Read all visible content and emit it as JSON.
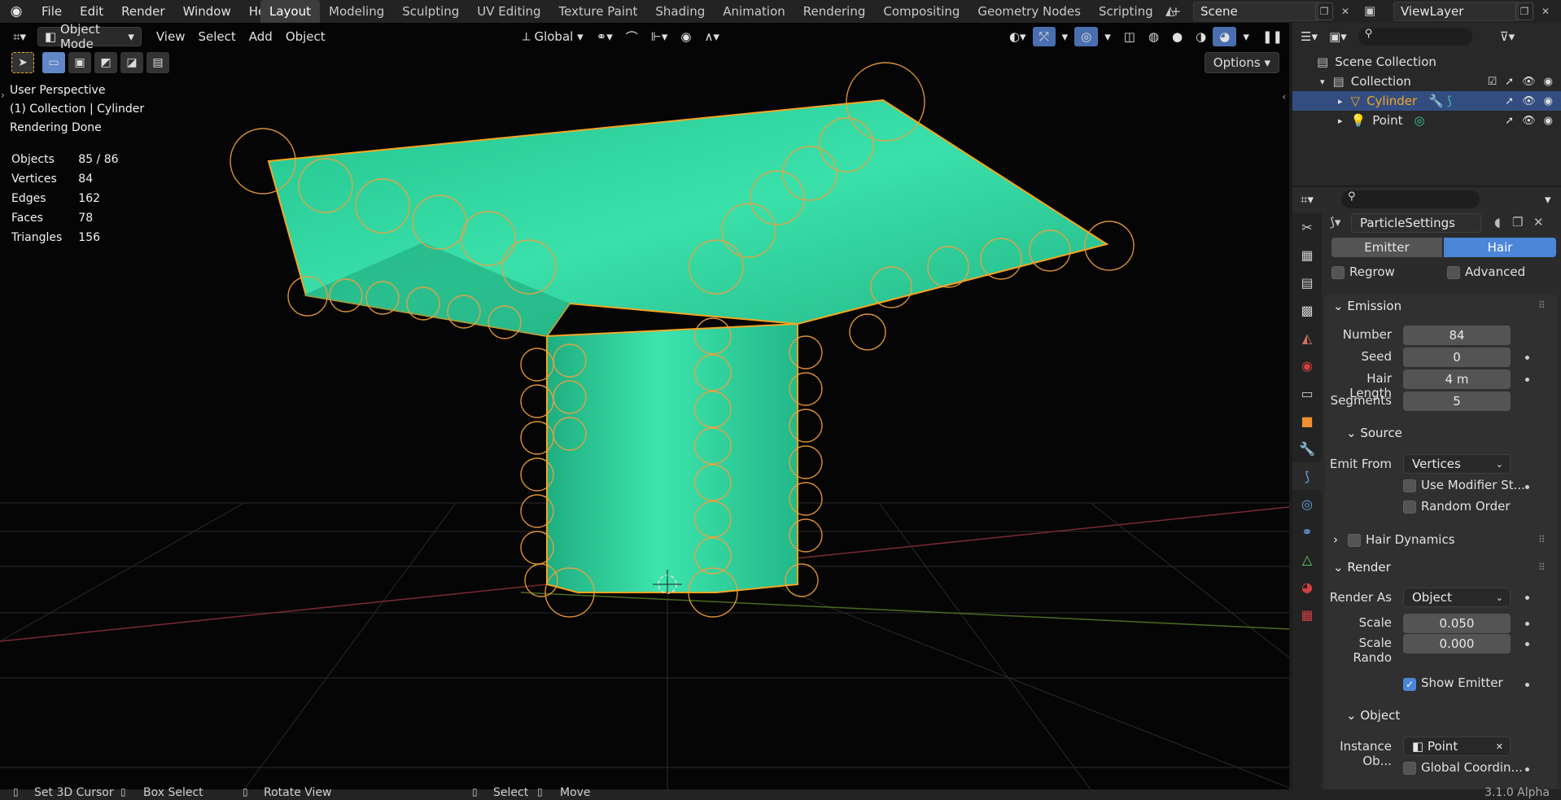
{
  "topbar": {
    "menu": [
      "File",
      "Edit",
      "Render",
      "Window",
      "Help"
    ],
    "workspaces": [
      "Layout",
      "Modeling",
      "Sculpting",
      "UV Editing",
      "Texture Paint",
      "Shading",
      "Animation",
      "Rendering",
      "Compositing",
      "Geometry Nodes",
      "Scripting"
    ],
    "add_tab": "+",
    "scene": "Scene",
    "view_layer": "ViewLayer"
  },
  "viewport": {
    "mode": "Object Mode",
    "menus": [
      "View",
      "Select",
      "Add",
      "Object"
    ],
    "orientation": "Global",
    "options_label": "Options",
    "overlay_lines": [
      "User Perspective",
      "(1) Collection | Cylinder",
      "Rendering Done"
    ],
    "stats": [
      {
        "label": "Objects",
        "value": "85 / 86"
      },
      {
        "label": "Vertices",
        "value": "84"
      },
      {
        "label": "Edges",
        "value": "162"
      },
      {
        "label": "Faces",
        "value": "78"
      },
      {
        "label": "Triangles",
        "value": "156"
      }
    ],
    "mesh_color": "#2bd39b",
    "selection_color": "#f5a623"
  },
  "outliner": {
    "root": "Scene Collection",
    "collection": "Collection",
    "items": [
      {
        "name": "Cylinder",
        "selected": true
      },
      {
        "name": "Point",
        "selected": false
      }
    ]
  },
  "properties": {
    "datablock": "ParticleSettings",
    "type_tabs": [
      "Emitter",
      "Hair"
    ],
    "active_type": "Hair",
    "regrow_label": "Regrow",
    "advanced_label": "Advanced",
    "emission": {
      "title": "Emission",
      "fields": [
        {
          "label": "Number",
          "value": "84"
        },
        {
          "label": "Seed",
          "value": "0"
        },
        {
          "label": "Hair Length",
          "value": "4 m"
        },
        {
          "label": "Segments",
          "value": "5"
        }
      ]
    },
    "source": {
      "title": "Source",
      "emit_from_label": "Emit From",
      "emit_from_value": "Vertices",
      "use_modifier_stack": "Use Modifier St...",
      "random_order": "Random Order"
    },
    "hair_dynamics": "Hair Dynamics",
    "render": {
      "title": "Render",
      "render_as_label": "Render As",
      "render_as_value": "Object",
      "scale_label": "Scale",
      "scale_value": "0.050",
      "scale_random_label": "Scale Rando",
      "scale_random_value": "0.000",
      "show_emitter": "Show Emitter"
    },
    "object": {
      "title": "Object",
      "instance_label": "Instance Ob...",
      "instance_value": "Point",
      "global_coords": "Global Coordin..."
    }
  },
  "statusbar": {
    "items": [
      "Set 3D Cursor",
      "Box Select",
      "Rotate View",
      "Select",
      "Move"
    ],
    "version": "3.1.0 Alpha"
  }
}
